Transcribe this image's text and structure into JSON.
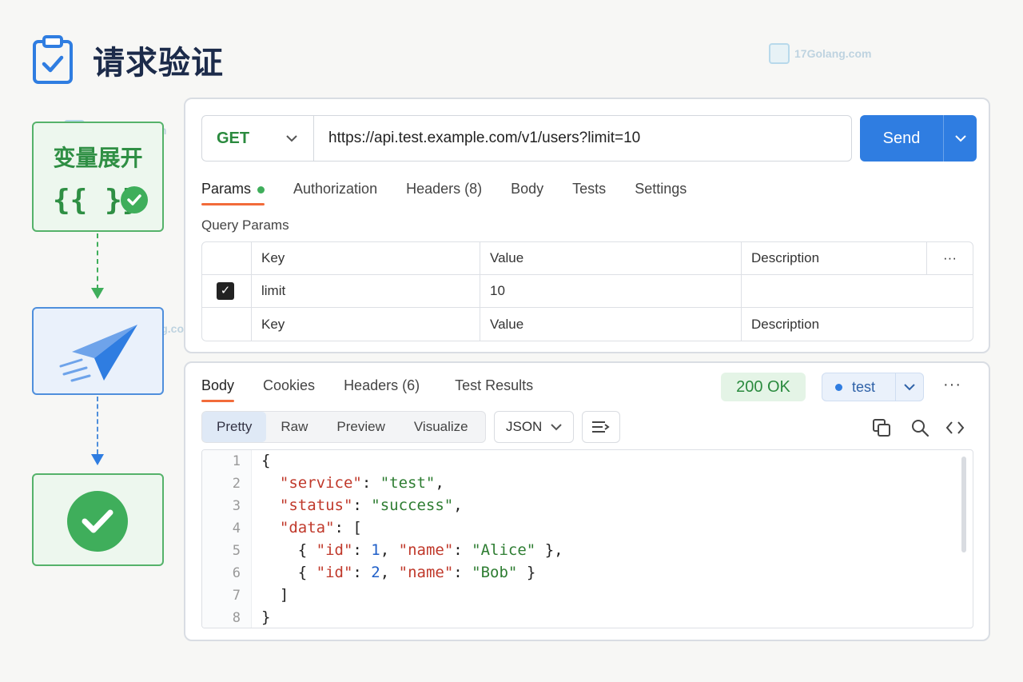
{
  "page": {
    "title": "请求验证"
  },
  "watermark": {
    "text": "17Golang.com"
  },
  "flow": {
    "step1_label": "变量展开",
    "step1_braces": "{{ }}"
  },
  "request": {
    "method": "GET",
    "url": "https://api.test.example.com/v1/users?limit=10",
    "send_label": "Send",
    "tabs": [
      "Params",
      "Authorization",
      "Headers (8)",
      "Body",
      "Tests",
      "Settings"
    ],
    "query_params_label": "Query Params",
    "table": {
      "headers": [
        "Key",
        "Value",
        "Description"
      ],
      "more": "···",
      "rows": [
        {
          "checked": true,
          "key": "limit",
          "value": "10",
          "description": ""
        }
      ],
      "placeholder": {
        "key": "Key",
        "value": "Value",
        "description": "Description"
      }
    }
  },
  "response": {
    "tabs": [
      "Body",
      "Cookies",
      "Headers (6)",
      "Test Results"
    ],
    "status": "200 OK",
    "environment": "test",
    "more": "···",
    "view_tabs": [
      "Pretty",
      "Raw",
      "Preview",
      "Visualize"
    ],
    "format": "JSON",
    "line_numbers": [
      "1",
      "2",
      "3",
      "4",
      "5",
      "6",
      "7",
      "8"
    ],
    "body": {
      "service": "test",
      "status": "success",
      "data": [
        {
          "id": 1,
          "name": "Alice"
        },
        {
          "id": 2,
          "name": "Bob"
        }
      ]
    }
  },
  "colors": {
    "accent_blue": "#2f7de1",
    "success_green": "#3fae5b",
    "tab_underline": "#f26b3a",
    "json_key": "#c0392b",
    "json_string": "#2e7d32",
    "json_number": "#1f5fc8"
  }
}
